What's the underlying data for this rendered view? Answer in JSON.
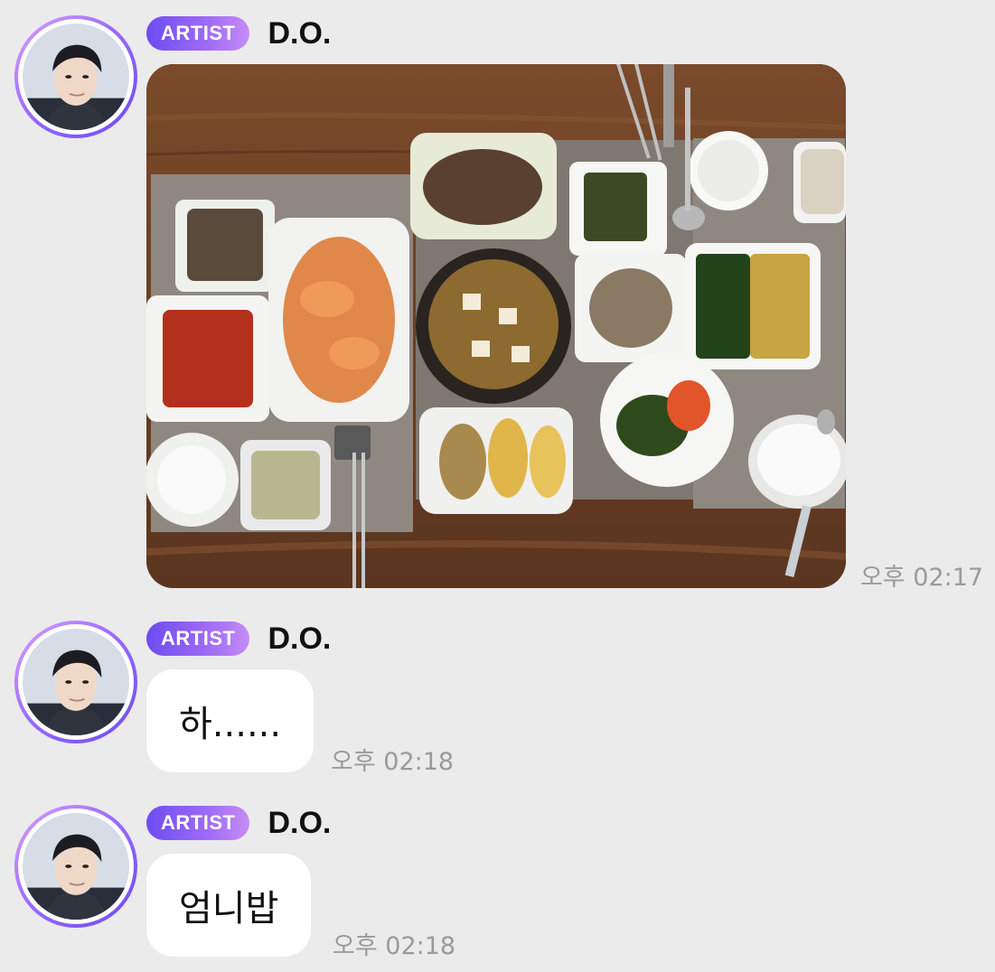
{
  "messages": [
    {
      "badge": "ARTIST",
      "sender": "D.O.",
      "type": "image",
      "image_description": "overhead view of korean home-cooked meal table",
      "time": "오후 02:17"
    },
    {
      "badge": "ARTIST",
      "sender": "D.O.",
      "type": "text",
      "text": "하......",
      "time": "오후 02:18"
    },
    {
      "badge": "ARTIST",
      "sender": "D.O.",
      "type": "text",
      "text": "엄니밥",
      "time": "오후 02:18"
    }
  ],
  "colors": {
    "background": "#ebebeb",
    "badge_start": "#6d4cf2",
    "badge_end": "#c58cf6",
    "bubble": "#ffffff",
    "timestamp": "#9a9a9a"
  },
  "icons": {
    "avatar": "profile-photo-avatar"
  }
}
